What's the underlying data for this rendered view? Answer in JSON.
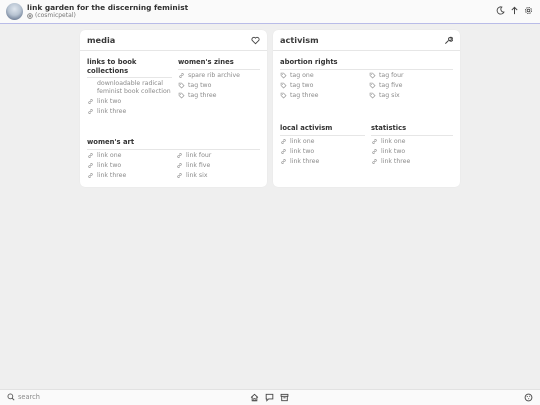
{
  "header": {
    "site_title": "link garden for the discerning feminist",
    "handle": "(cosmicpetal)",
    "icons": [
      "moon-icon",
      "arrow-up-icon",
      "gear-icon"
    ]
  },
  "cards": {
    "media": {
      "title": "media",
      "icon": "heart-icon",
      "sections": {
        "books": {
          "title": "links to book collections",
          "items": [
            "downloadable radical feminist book collection",
            "link two",
            "link three"
          ]
        },
        "zines": {
          "title": "women's zines",
          "items": [
            "spare rib archive",
            "tag two",
            "tag three"
          ]
        },
        "art": {
          "title": "women's art",
          "col1": [
            "link one",
            "link two",
            "link three"
          ],
          "col2": [
            "link four",
            "link five",
            "link six"
          ]
        }
      }
    },
    "activism": {
      "title": "activism",
      "icon": "wrench-icon",
      "sections": {
        "abortion": {
          "title": "abortion rights",
          "col1": [
            "tag one",
            "tag two",
            "tag three"
          ],
          "col2": [
            "tag four",
            "tag five",
            "tag six"
          ]
        },
        "local": {
          "title": "local activism",
          "items": [
            "link one",
            "link two",
            "link three"
          ]
        },
        "stats": {
          "title": "statistics",
          "items": [
            "link one",
            "link two",
            "link three"
          ]
        }
      }
    }
  },
  "footer": {
    "search_label": "search",
    "icons": [
      "home-icon",
      "chat-icon",
      "archive-icon",
      "cookie-icon"
    ]
  }
}
